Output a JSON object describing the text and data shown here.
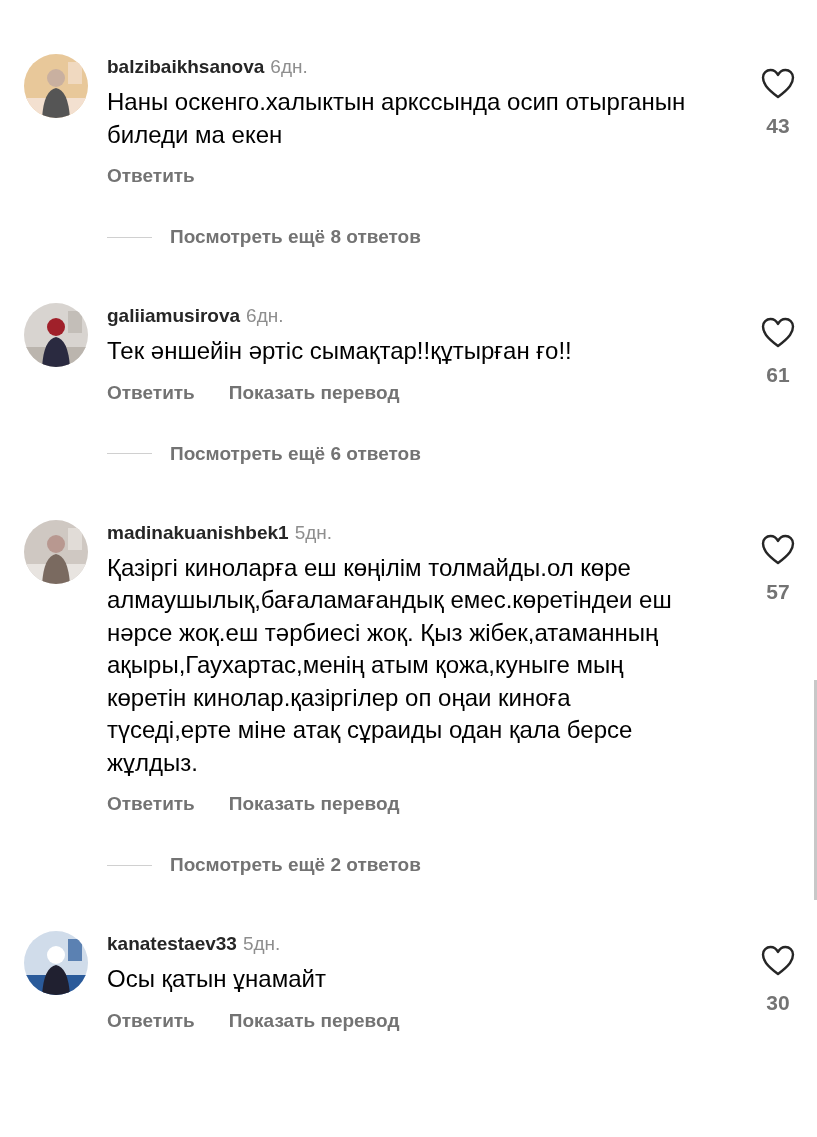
{
  "comments": [
    {
      "username": "balzibaikhsanova",
      "time": "6дн.",
      "text": "Наны оскенго.халыктын арксcында осип отырганын биледи ма екен",
      "reply": "Ответить",
      "liked": false,
      "likes": "43",
      "more_replies": "Посмотреть ещё 8 ответов"
    },
    {
      "username": "galiiamusirova",
      "time": "6дн.",
      "text": "Тек әншейін әртіс сымақтар!!құтырған ғо!!",
      "reply": "Ответить",
      "translate": "Показать перевод",
      "liked": false,
      "likes": "61",
      "more_replies": "Посмотреть ещё 6 ответов"
    },
    {
      "username": "madinakuanishbek1",
      "time": "5дн.",
      "text": "Қазіргі киноларға еш көңілім толмайды.ол көре алмаушылық,бағаламағандық емес.көретіндеи еш нәрсе жоқ.еш тәрбиесі жоқ. Қыз жібек,атаманның ақыры,Гаухартас,менің атым қожа,куныге мың көретін кинолар.қазіргілер оп оңаи киноға  түседі,ерте міне атақ сұраиды одан қала берсе жұлдыз.",
      "reply": "Ответить",
      "translate": "Показать перевод",
      "liked": false,
      "likes": "57",
      "more_replies": "Посмотреть ещё 2 ответов"
    },
    {
      "username": "kanatestaev33",
      "time": "5дн.",
      "text": "Осы қатын ұнамайт",
      "reply": "Ответить",
      "translate": "Показать перевод",
      "liked": false,
      "likes": "30"
    }
  ]
}
